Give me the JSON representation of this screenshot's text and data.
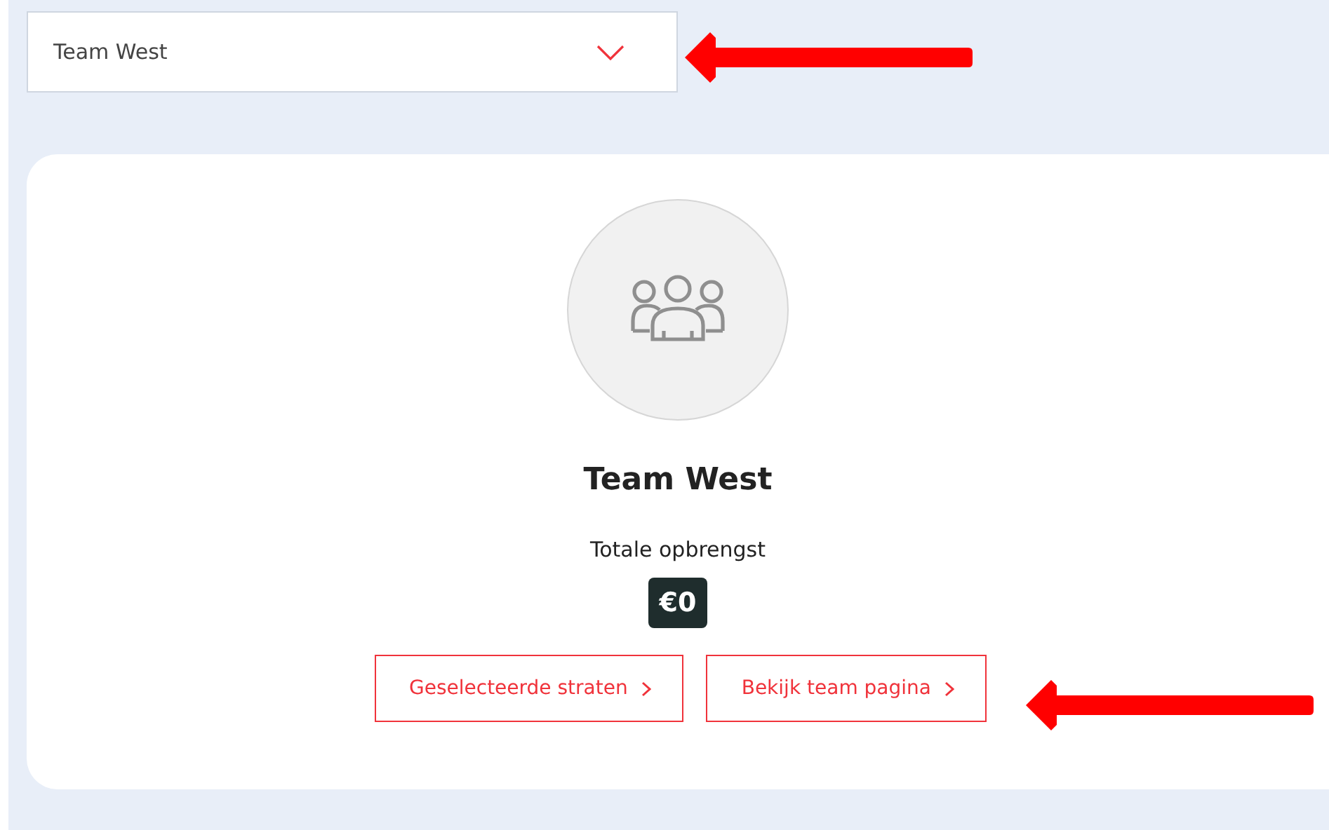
{
  "team_select": {
    "value": "Team West"
  },
  "team_card": {
    "name": "Team West",
    "revenue_label": "Totale opbrengst",
    "revenue": "€0"
  },
  "buttons": [
    {
      "label": "Geselecteerde straten"
    },
    {
      "label": "Bekijk team pagina"
    }
  ],
  "annotations": [
    {
      "kind": "arrow"
    },
    {
      "kind": "arrow"
    }
  ]
}
